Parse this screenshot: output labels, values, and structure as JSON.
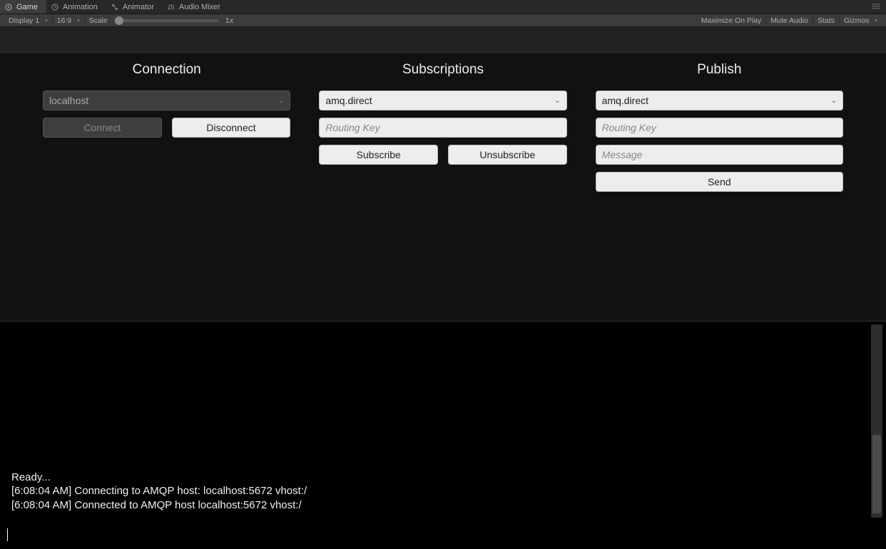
{
  "tabs": [
    {
      "label": "Game",
      "active": true
    },
    {
      "label": "Animation",
      "active": false
    },
    {
      "label": "Animator",
      "active": false
    },
    {
      "label": "Audio Mixer",
      "active": false
    }
  ],
  "options": {
    "display": "Display 1",
    "aspect": "16:9",
    "scale_label": "Scale",
    "scale_value": "1x",
    "maximize": "Maximize On Play",
    "mute": "Mute Audio",
    "stats": "Stats",
    "gizmos": "Gizmos"
  },
  "connection": {
    "title": "Connection",
    "host_value": "localhost",
    "connect_label": "Connect",
    "disconnect_label": "Disconnect"
  },
  "subscriptions": {
    "title": "Subscriptions",
    "exchange_value": "amq.direct",
    "routing_key_placeholder": "Routing Key",
    "subscribe_label": "Subscribe",
    "unsubscribe_label": "Unsubscribe"
  },
  "publish": {
    "title": "Publish",
    "exchange_value": "amq.direct",
    "routing_key_placeholder": "Routing Key",
    "message_placeholder": "Message",
    "send_label": "Send"
  },
  "log": {
    "lines": [
      "Ready...",
      "[6:08:04 AM] Connecting to AMQP host: localhost:5672 vhost:/",
      "[6:08:04 AM] Connected to AMQP host localhost:5672 vhost:/"
    ]
  }
}
